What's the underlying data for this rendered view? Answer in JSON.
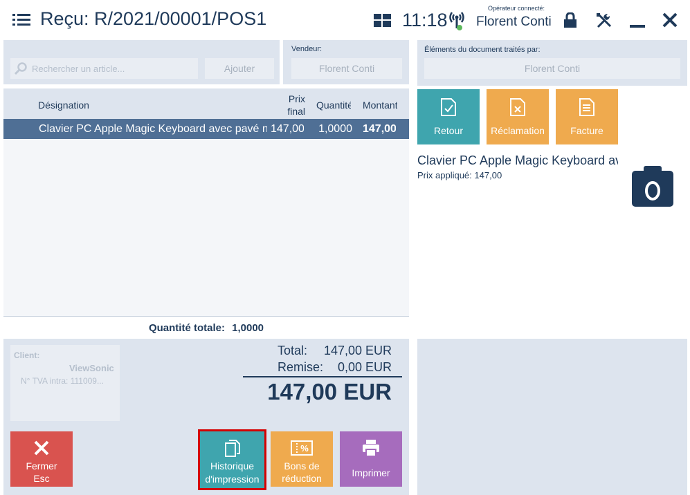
{
  "header": {
    "title": "Reçu: R/2021/00001/POS1",
    "time": "11:18",
    "operator_caption": "Opérateur connecté:",
    "operator_name": "Florent Conti"
  },
  "search": {
    "placeholder": "Rechercher un article...",
    "add_label": "Ajouter"
  },
  "seller": {
    "caption": "Vendeur:",
    "value": "Florent Conti"
  },
  "table": {
    "headers": {
      "designation": "Désignation",
      "final_price_1": "Prix",
      "final_price_2": "final",
      "quantity": "Quantité",
      "amount": "Montant"
    },
    "rows": [
      {
        "designation": "Clavier PC Apple Magic Keyboard avec pavé numérique",
        "final_price": "147,00",
        "quantity": "1,0000",
        "amount": "147,00"
      }
    ]
  },
  "total_quantity": {
    "label": "Quantité totale:",
    "value": "1,0000"
  },
  "client": {
    "label": "Client:",
    "name": "ViewSonic",
    "vat": "N° TVA intra: 111009..."
  },
  "summary": {
    "total_label": "Total:",
    "total_value": "147,00 EUR",
    "discount_label": "Remise:",
    "discount_value": "0,00 EUR",
    "grand_total": "147,00 EUR"
  },
  "actions": {
    "close_label": "Fermer",
    "close_shortcut": "Esc",
    "print_history_1": "Historique",
    "print_history_2": "d'impression",
    "coupons_1": "Bons de",
    "coupons_2": "réduction",
    "print": "Imprimer"
  },
  "right_panel": {
    "processed_caption": "Éléments du document traités par:",
    "processed_value": "Florent Conti",
    "tiles": {
      "return": "Retour",
      "complaint": "Réclamation",
      "invoice": "Facture"
    },
    "item_name": "Clavier PC Apple Magic Keyboard avec pavé numérique",
    "price_label": "Prix appliqué:",
    "price_value": "147,00"
  },
  "colors": {
    "navy": "#1f3a5a",
    "panel": "#dde4ee",
    "row_selected": "#4f6f95",
    "red": "#d9534f",
    "teal": "#3fa5ae",
    "orange": "#efaa4e",
    "purple": "#a66cbd",
    "highlight_border": "#d40000"
  }
}
